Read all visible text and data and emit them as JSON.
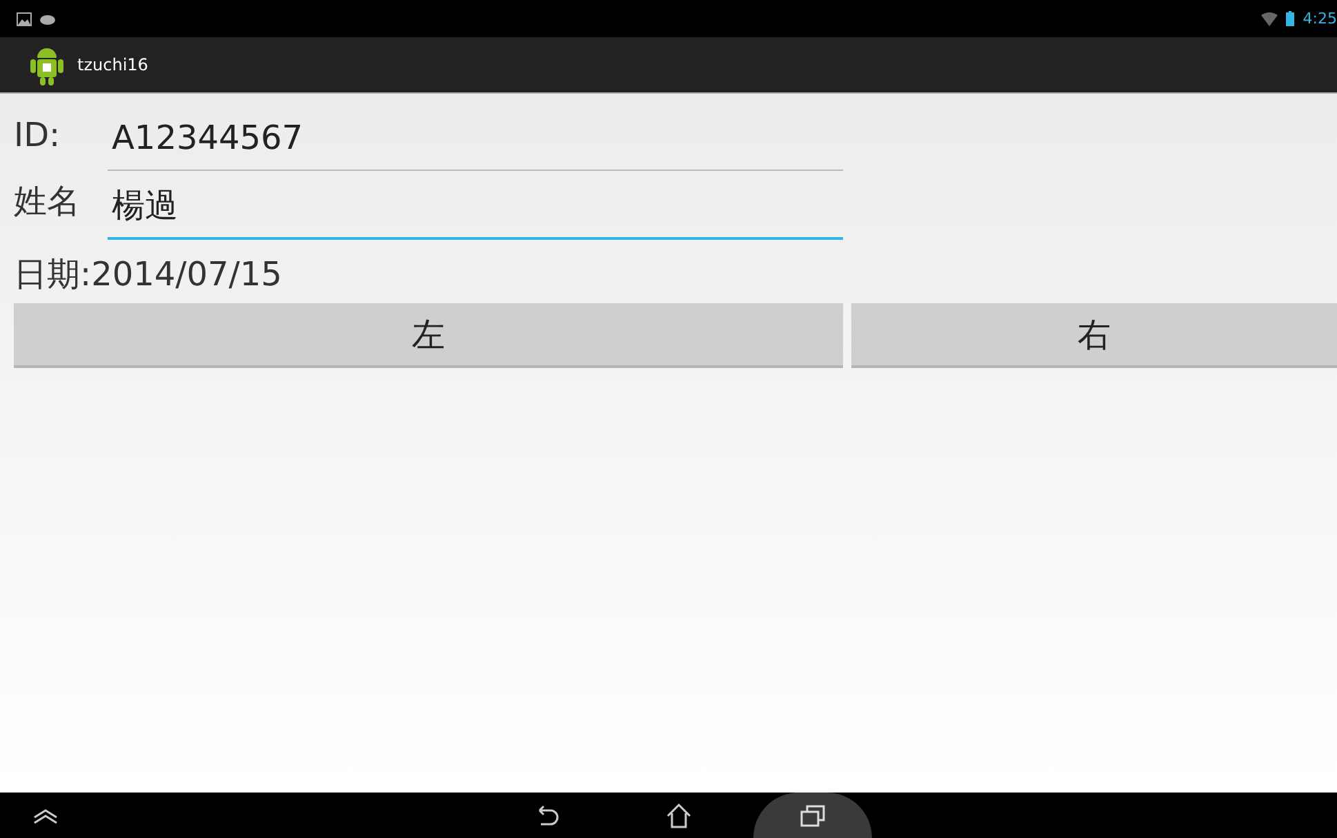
{
  "status_bar": {
    "time": "4:25"
  },
  "action_bar": {
    "title": "tzuchi16"
  },
  "fields": [
    {
      "label": "ID:",
      "value": "A12344567",
      "focused": false
    },
    {
      "label": "姓名",
      "value": "楊過",
      "focused": true
    }
  ],
  "date_text": "日期:2014/07/15",
  "buttons": [
    "左",
    "右"
  ]
}
